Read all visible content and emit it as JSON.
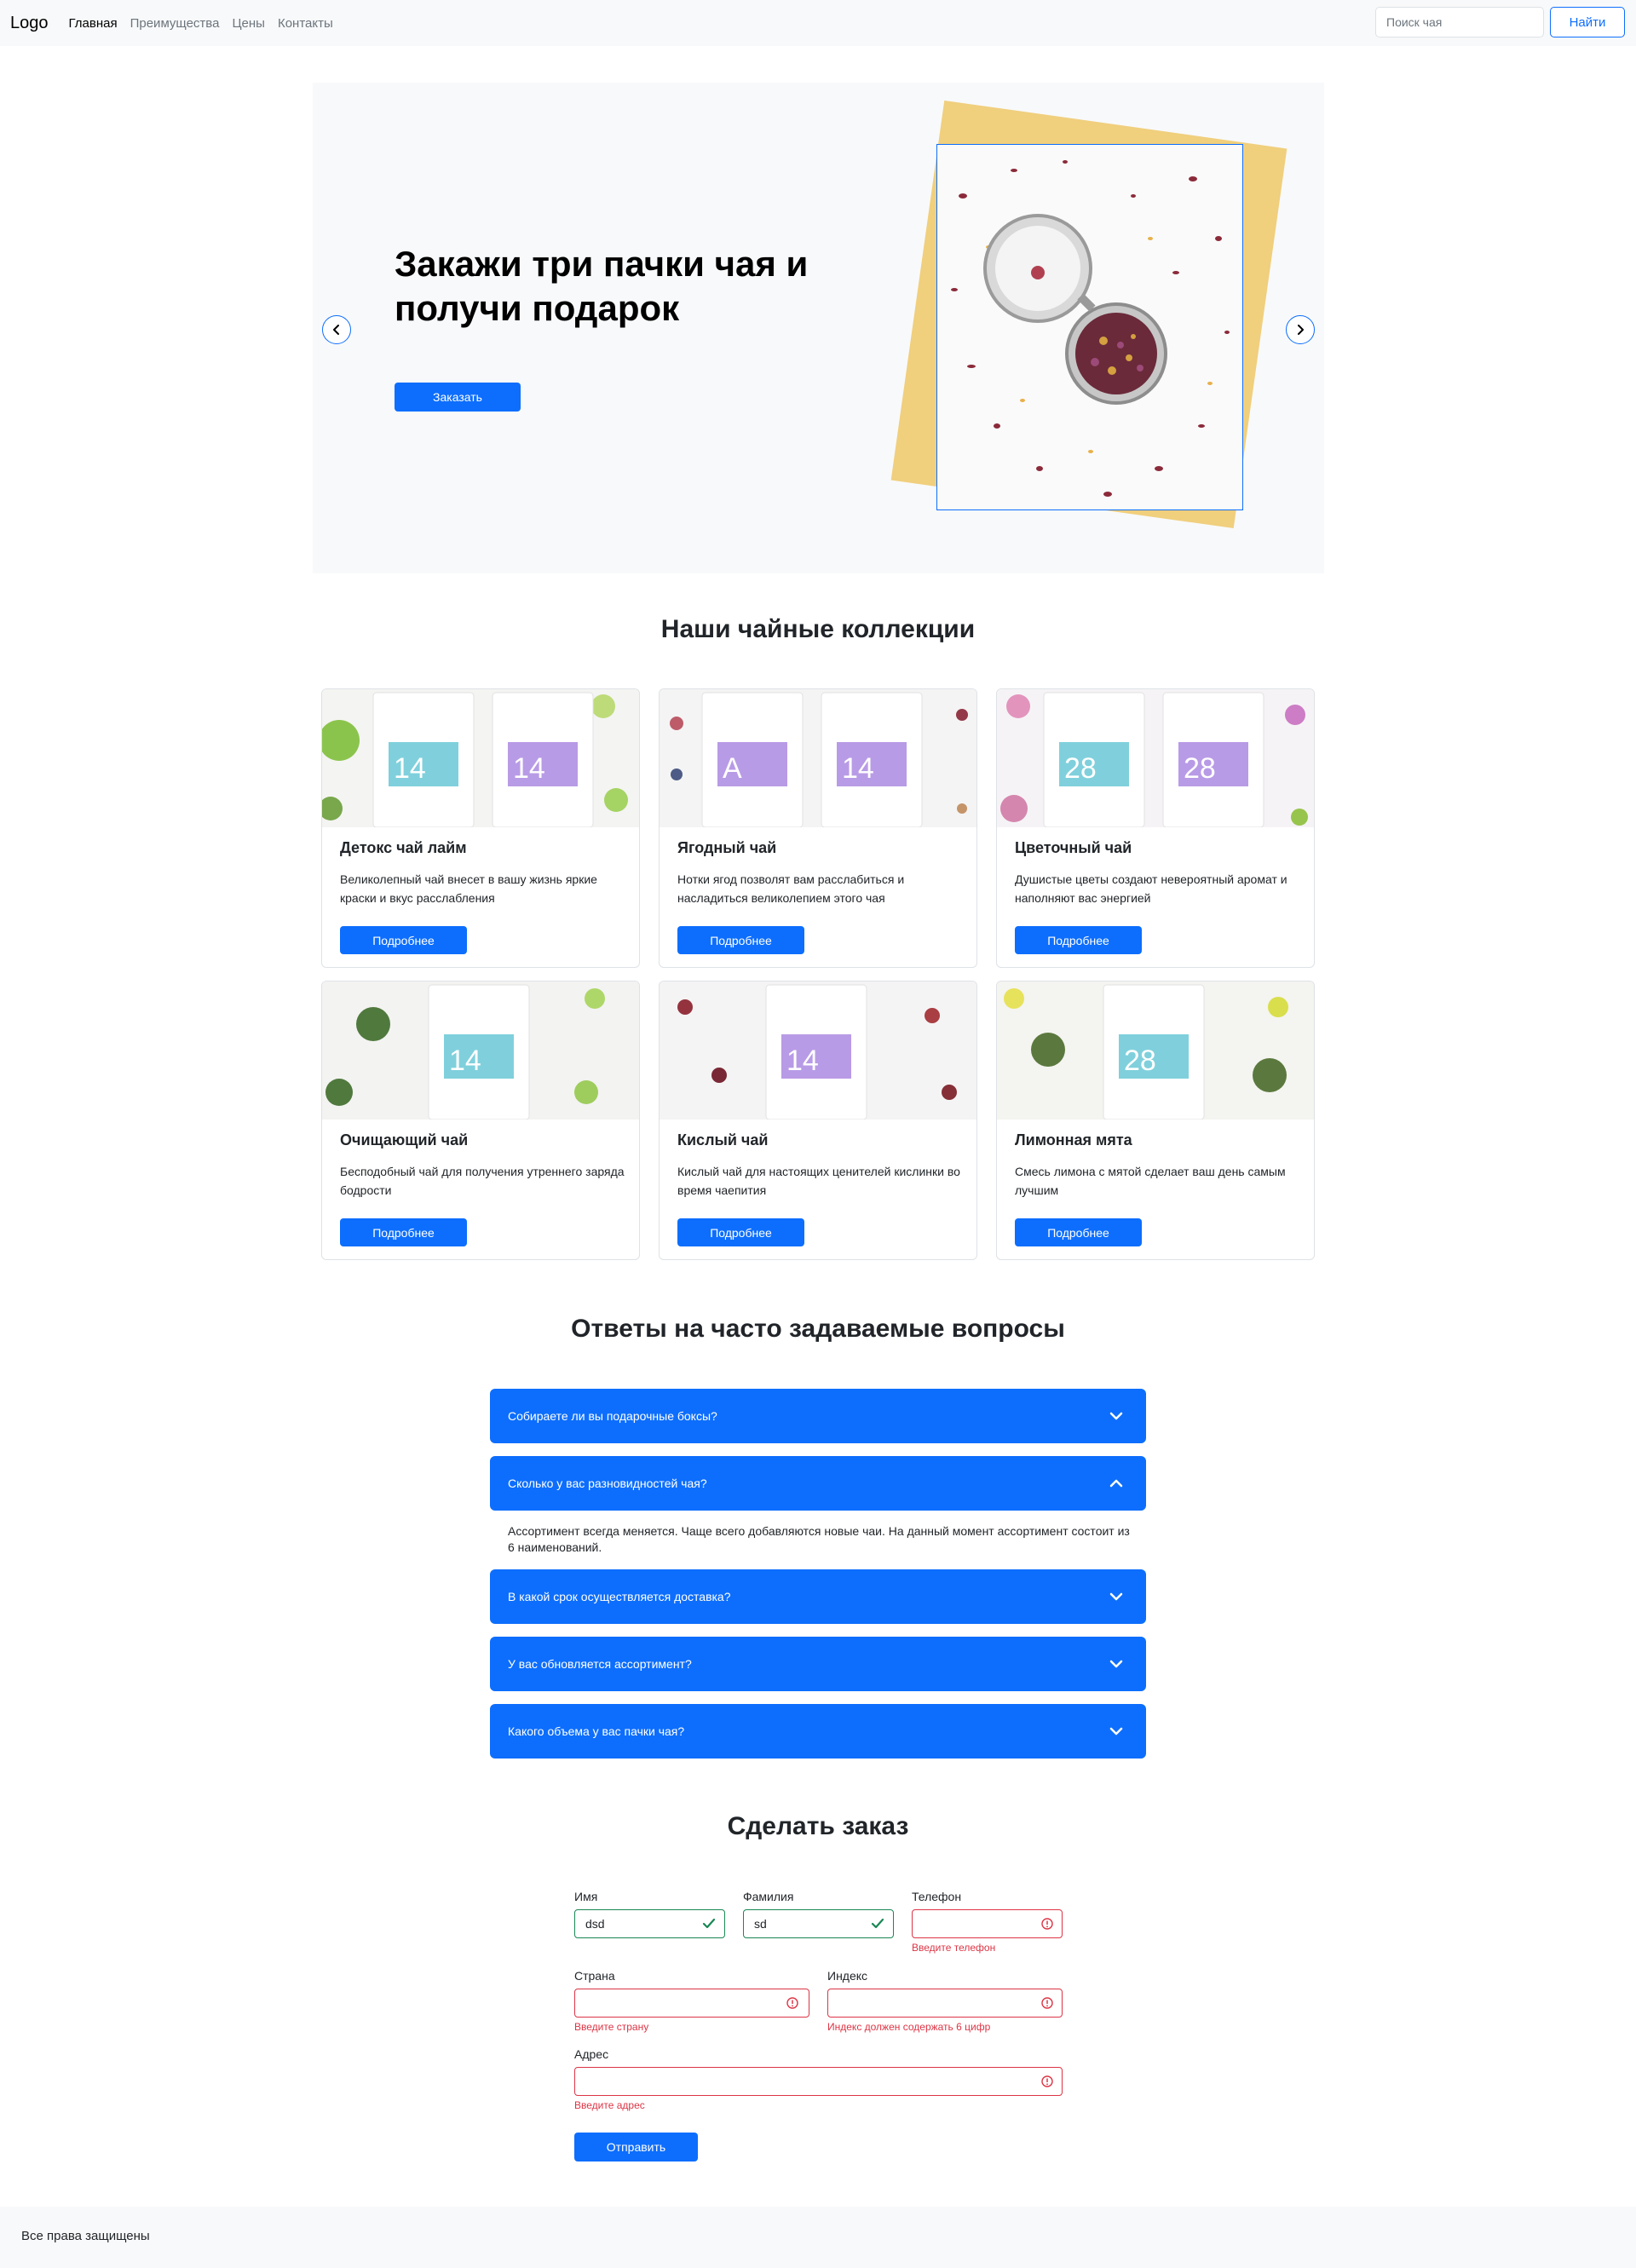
{
  "nav": {
    "logo": "Logo",
    "links": [
      "Главная",
      "Преимущества",
      "Цены",
      "Контакты"
    ],
    "search_placeholder": "Поиск чая",
    "search_button": "Найти"
  },
  "hero": {
    "title": "Закажи три пачки чая и получи подарок",
    "button": "Заказать"
  },
  "collections": {
    "title": "Наши чайные коллекции",
    "cards": [
      {
        "title": "Детокс чай лайм",
        "text": "Великолепный чай внесет в вашу жизнь яркие краски и вкус расслабления",
        "button": "Подробнее",
        "pack_labels": [
          "14",
          "14"
        ]
      },
      {
        "title": "Ягодный чай",
        "text": "Нотки ягод позволят вам расслабиться и насладиться великолепием этого чая",
        "button": "Подробнее",
        "pack_labels": [
          "A",
          "14"
        ]
      },
      {
        "title": "Цветочный чай",
        "text": "Душистые цветы создают невероятный аромат и наполняют вас энергией",
        "button": "Подробнее",
        "pack_labels": [
          "28",
          "28"
        ]
      },
      {
        "title": "Очищающий чай",
        "text": "Бесподобный чай для получения утреннего заряда бодрости",
        "button": "Подробнее",
        "pack_labels": [
          "14"
        ]
      },
      {
        "title": "Кислый чай",
        "text": "Кислый чай для настоящих ценителей кислинки во время чаепития",
        "button": "Подробнее",
        "pack_labels": [
          "14"
        ]
      },
      {
        "title": "Лимонная мята",
        "text": "Смесь лимона с мятой сделает ваш день самым лучшим",
        "button": "Подробнее",
        "pack_labels": [
          "28"
        ]
      }
    ]
  },
  "faq": {
    "title": "Ответы на часто задаваемые вопросы",
    "items": [
      {
        "question": "Собираете ли вы подарочные боксы?",
        "expanded": false
      },
      {
        "question": "Сколько у вас разновидностей чая?",
        "expanded": true,
        "answer": "Ассортимент всегда меняется. Чаще всего добавляются новые чаи. На данный момент ассортимент состоит из 6 наименований."
      },
      {
        "question": "В какой срок осуществляется доставка?",
        "expanded": false
      },
      {
        "question": "У вас обновляется ассортимент?",
        "expanded": false
      },
      {
        "question": "Какого объема у вас пачки чая?",
        "expanded": false
      }
    ]
  },
  "order": {
    "title": "Сделать заказ",
    "fields": {
      "name": {
        "label": "Имя",
        "value": "dsd",
        "state": "valid"
      },
      "surname": {
        "label": "Фамилия",
        "value": "sd",
        "state": "valid"
      },
      "phone": {
        "label": "Телефон",
        "value": "",
        "state": "invalid",
        "error": "Введите телефон"
      },
      "country": {
        "label": "Страна",
        "value": "",
        "state": "invalid",
        "error": "Введите страну"
      },
      "index": {
        "label": "Индекс",
        "value": "",
        "state": "invalid",
        "error": "Индекс должен содержать 6 цифр"
      },
      "address": {
        "label": "Адрес",
        "value": "",
        "state": "invalid",
        "error": "Введите адрес"
      }
    },
    "submit": "Отправить"
  },
  "footer": {
    "text": "Все права защищены"
  },
  "colors": {
    "primary": "#0d6efd",
    "valid": "#198754",
    "invalid": "#dc3545",
    "light_bg": "#f8f9fa",
    "hero_backdrop": "#f0cf7d"
  }
}
